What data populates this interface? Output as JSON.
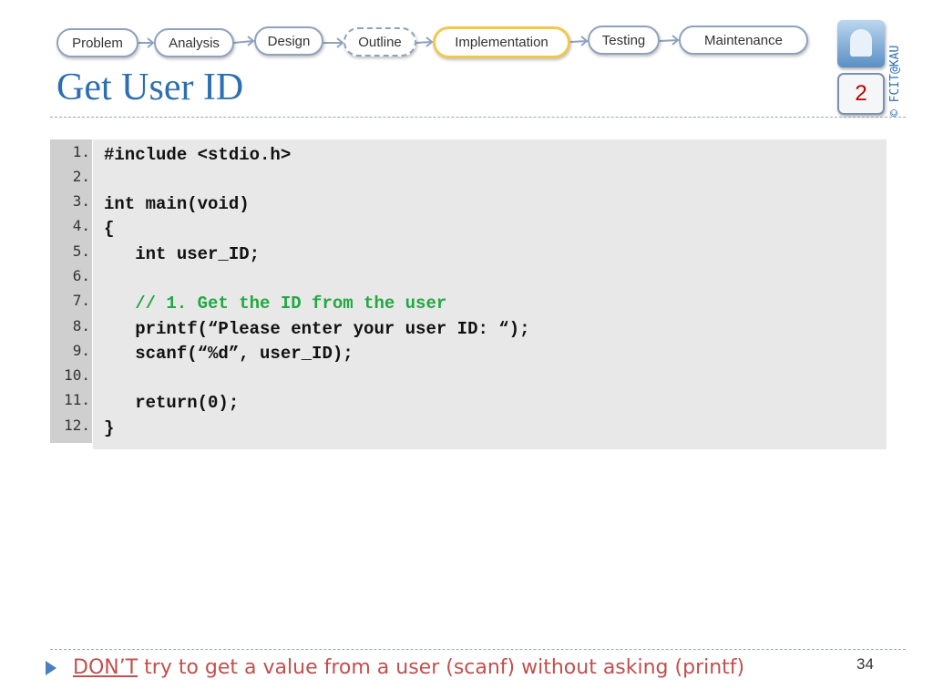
{
  "flow": {
    "steps": [
      "Problem",
      "Analysis",
      "Design",
      "Outline",
      "Implementation",
      "Testing",
      "Maintenance"
    ],
    "active": "Implementation"
  },
  "title": "Get User ID",
  "badge": "2",
  "copyright": "© FCIT@KAU",
  "code": {
    "line_numbers": [
      "1.",
      "2.",
      "3.",
      "4.",
      "5.",
      "6.",
      "7.",
      "8.",
      "9.",
      "10.",
      "11.",
      "12."
    ],
    "lines": [
      "#include <stdio.h>",
      "",
      "int main(void)",
      "{",
      "   int user_ID;",
      "",
      "   // 1. Get the ID from the user",
      "   printf(“Please enter your user ID: “);",
      "   scanf(“%d”, user_ID);",
      "",
      "   return(0);",
      "}"
    ]
  },
  "footer": {
    "emphasis": "DON’T",
    "text": " try to get a value from a user (scanf) without asking (printf)"
  },
  "page_number": "34",
  "colors": {
    "title": "#2e6fb0",
    "comment": "#22a842",
    "footer": "#c0504d",
    "active_border": "#f0c84e"
  }
}
